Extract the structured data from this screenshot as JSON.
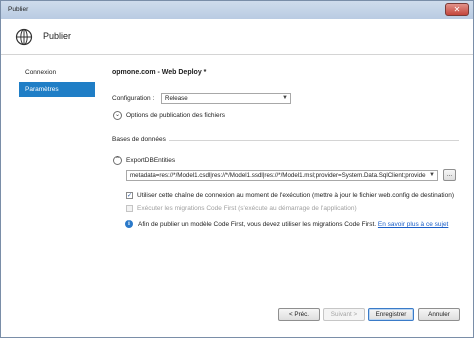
{
  "window": {
    "title": "Publier",
    "close_glyph": "✕"
  },
  "header": {
    "title": "Publier",
    "icon": "globe-icon"
  },
  "sidebar": {
    "items": [
      {
        "label": "Connexion",
        "active": false
      },
      {
        "label": "Paramètres",
        "active": true
      }
    ]
  },
  "main": {
    "title": "opmone.com - Web Deploy *",
    "configuration": {
      "label": "Configuration :",
      "value": "Release"
    },
    "file_options": {
      "label": "Options de publication des fichiers"
    },
    "databases": {
      "section_label": "Bases de données",
      "entry_name": "ExportDBEntities",
      "connection_string": "metadata=res://*/Model1.csdl|res://*/Model1.ssdl|res://*/Model1.msl;provider=System.Data.SqlClient;provide",
      "browse_label": "...",
      "use_connection_string": {
        "label": "Utiliser cette chaîne de connexion au moment de l'exécution (mettre à jour le fichier web.config de destination)",
        "checked": true
      },
      "code_first": {
        "label": "Exécuter les migrations Code First (s'exécute au démarrage de l'application)",
        "checked": false,
        "enabled": false
      },
      "info": {
        "text": "Afin de publier un modèle Code First, vous devez utiliser les migrations Code First.",
        "link": "En savoir plus à ce sujet"
      }
    }
  },
  "footer": {
    "prev_label": "< Préc.",
    "next_label": "Suivant >",
    "save_label": "Enregistrer",
    "cancel_label": "Annuler"
  },
  "colors": {
    "accent": "#1f7ec6",
    "link": "#1a5ec7"
  }
}
